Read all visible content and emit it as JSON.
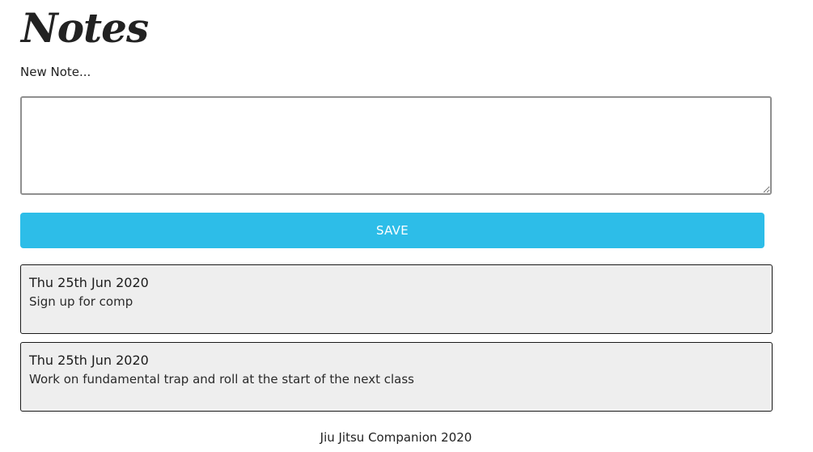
{
  "header": {
    "title": "Notes"
  },
  "form": {
    "label": "New Note...",
    "input_value": "",
    "save_label": "SAVE"
  },
  "notes": [
    {
      "date": "Thu 25th Jun 2020",
      "text": "Sign up for comp"
    },
    {
      "date": "Thu 25th Jun 2020",
      "text": "Work on fundamental trap and roll at the start of the next class"
    }
  ],
  "footer": {
    "text": "Jiu Jitsu Companion 2020"
  },
  "colors": {
    "accent": "#2dbde8",
    "card_background": "#eeeeee",
    "card_border": "#1a1a1a"
  }
}
